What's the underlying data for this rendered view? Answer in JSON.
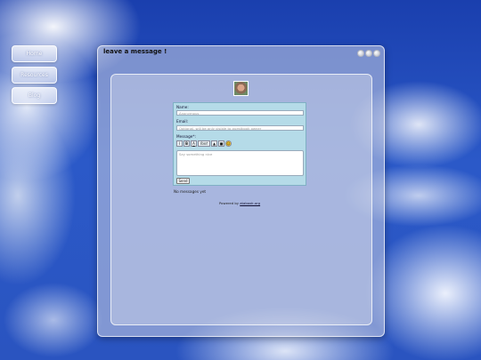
{
  "nav": {
    "items": [
      {
        "label": "Home"
      },
      {
        "label": "Resources"
      },
      {
        "label": "Blog"
      }
    ]
  },
  "window": {
    "title": "leave a message !"
  },
  "form": {
    "name_label": "Name:",
    "name_placeholder": "Anonymous",
    "email_label": "Email:",
    "email_placeholder": "Optional, will be only visible to guestbook owner",
    "message_label": "Message*:",
    "toolbar": {
      "italic": "I",
      "bold": "B",
      "underline": "A",
      "font": "font",
      "image": "▲",
      "color": "■",
      "emoji": "☺"
    },
    "message_placeholder": "Say something nice",
    "send_label": "Send"
  },
  "status": {
    "no_messages": "No messages yet"
  },
  "footer": {
    "powered_prefix": "Powered by ",
    "powered_link": "atabook.org"
  }
}
